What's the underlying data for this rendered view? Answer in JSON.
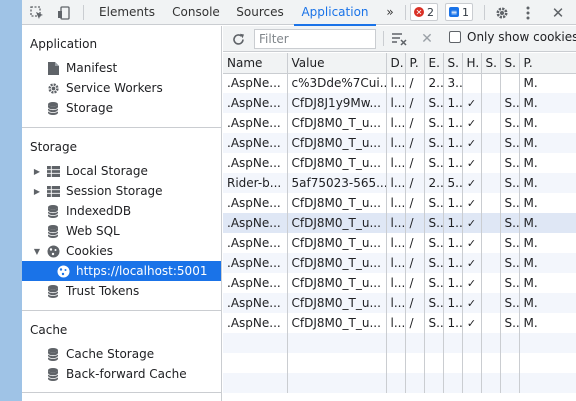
{
  "topbar": {
    "tabs": [
      "Elements",
      "Console",
      "Sources",
      "Application"
    ],
    "active_tab": "Application",
    "more": "»",
    "errors_count": "2",
    "messages_count": "1"
  },
  "sidebar": {
    "application": {
      "title": "Application",
      "items": [
        "Manifest",
        "Service Workers",
        "Storage"
      ]
    },
    "storage": {
      "title": "Storage",
      "items": [
        "Local Storage",
        "Session Storage",
        "IndexedDB",
        "Web SQL",
        "Cookies"
      ],
      "cookie_origin": "https://localhost:5001",
      "trust_tokens": "Trust Tokens"
    },
    "cache": {
      "title": "Cache",
      "items": [
        "Cache Storage",
        "Back-forward Cache"
      ]
    }
  },
  "toolbar": {
    "filter_placeholder": "Filter",
    "only_show": "Only show cookies w"
  },
  "table": {
    "columns": [
      "Name",
      "Value",
      "D.",
      "P.",
      "E.",
      "S.",
      "H.",
      "S.",
      "S.",
      "P."
    ],
    "rows": [
      [
        ".AspNe...",
        "c%3Dde%7Cui...",
        "l...",
        "/",
        "2...",
        "3...",
        "",
        "",
        "",
        "M."
      ],
      [
        ".AspNe...",
        "CfDJ8J1y9Mw...",
        "l...",
        "/",
        "S...",
        "1...",
        "✓",
        "",
        "S...",
        "M."
      ],
      [
        ".AspNe...",
        "CfDJ8M0_T_u...",
        "l...",
        "/",
        "S...",
        "1...",
        "✓",
        "",
        "S...",
        "M."
      ],
      [
        ".AspNe...",
        "CfDJ8M0_T_u...",
        "l...",
        "/",
        "S...",
        "1...",
        "✓",
        "",
        "S...",
        "M."
      ],
      [
        ".AspNe...",
        "CfDJ8M0_T_u...",
        "l...",
        "/",
        "S...",
        "1...",
        "✓",
        "",
        "S...",
        "M."
      ],
      [
        "Rider-b...",
        "5af75023-565...",
        "l...",
        "/",
        "2...",
        "5...",
        "✓",
        "",
        "S...",
        "M."
      ],
      [
        ".AspNe...",
        "CfDJ8M0_T_u...",
        "l...",
        "/",
        "S...",
        "1...",
        "✓",
        "",
        "S...",
        "M."
      ],
      [
        ".AspNe...",
        "CfDJ8M0_T_u...",
        "l...",
        "/",
        "S...",
        "1...",
        "✓",
        "",
        "S...",
        "M."
      ],
      [
        ".AspNe...",
        "CfDJ8M0_T_u...",
        "l...",
        "/",
        "S...",
        "1...",
        "✓",
        "",
        "S...",
        "M."
      ],
      [
        ".AspNe...",
        "CfDJ8M0_T_u...",
        "l...",
        "/",
        "S...",
        "1...",
        "✓",
        "",
        "S...",
        "M."
      ],
      [
        ".AspNe...",
        "CfDJ8M0_T_u...",
        "l...",
        "/",
        "S...",
        "1...",
        "✓",
        "",
        "S...",
        "M."
      ],
      [
        ".AspNe...",
        "CfDJ8M0_T_u...",
        "l...",
        "/",
        "S...",
        "1...",
        "✓",
        "",
        "S...",
        "M."
      ],
      [
        ".AspNe...",
        "CfDJ8M0_T_u...",
        "l...",
        "/",
        "S...",
        "1...",
        "✓",
        "",
        "S...",
        "M."
      ]
    ]
  },
  "colors": {
    "accent": "#1a73e8",
    "error": "#d93025",
    "toolbar_bg": "#f1f3f4",
    "border": "#cacdd1"
  }
}
